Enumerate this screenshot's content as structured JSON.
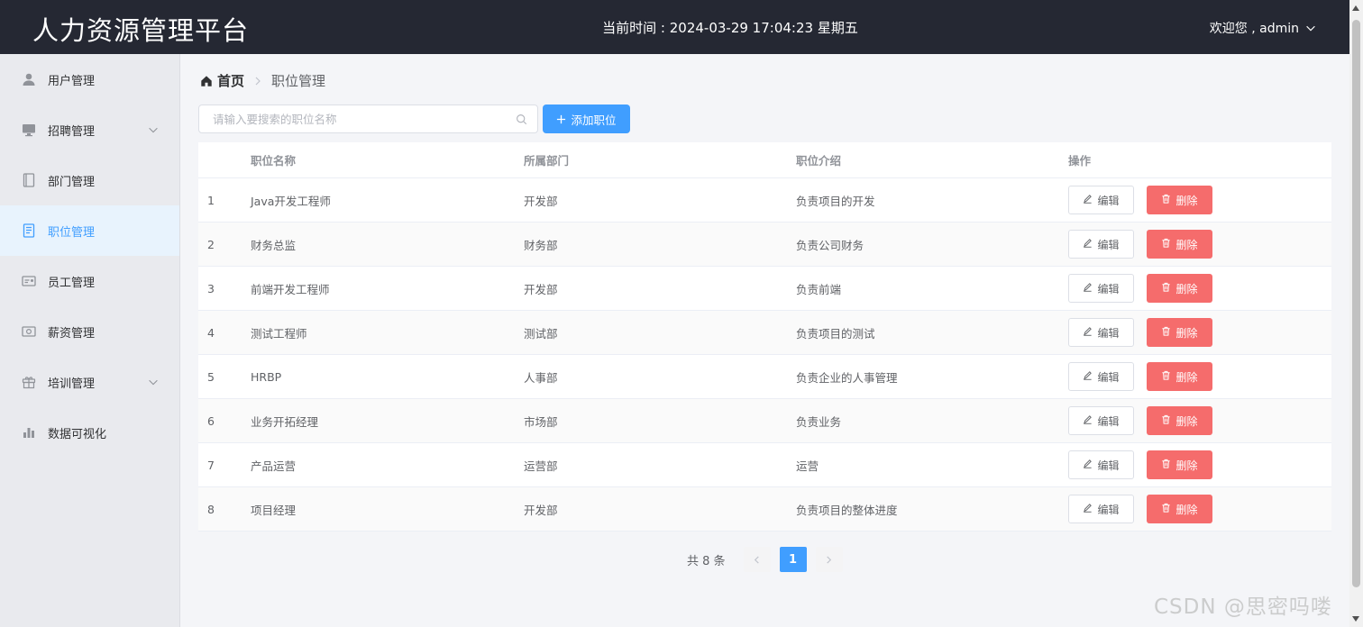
{
  "header": {
    "title": "人力资源管理平台",
    "clock": "当前时间 : 2024-03-29 17:04:23 星期五",
    "user": "欢迎您 , admin"
  },
  "sidebar": {
    "items": [
      {
        "label": "用户管理",
        "icon": "user-icon",
        "has_submenu": false
      },
      {
        "label": "招聘管理",
        "icon": "monitor-icon",
        "has_submenu": true
      },
      {
        "label": "部门管理",
        "icon": "notebook-icon",
        "has_submenu": false
      },
      {
        "label": "职位管理",
        "icon": "document-icon",
        "has_submenu": false,
        "active": true
      },
      {
        "label": "员工管理",
        "icon": "id-card-icon",
        "has_submenu": false
      },
      {
        "label": "薪资管理",
        "icon": "money-icon",
        "has_submenu": false
      },
      {
        "label": "培训管理",
        "icon": "gift-box-icon",
        "has_submenu": true
      },
      {
        "label": "数据可视化",
        "icon": "bar-chart-icon",
        "has_submenu": false
      }
    ]
  },
  "breadcrumb": {
    "home": "首页",
    "current": "职位管理"
  },
  "search": {
    "placeholder": "请输入要搜索的职位名称",
    "value": ""
  },
  "toolbar": {
    "add_label": "添加职位"
  },
  "table": {
    "columns": [
      "",
      "职位名称",
      "所属部门",
      "职位介绍",
      "操作"
    ],
    "rows": [
      {
        "index": "1",
        "name": "Java开发工程师",
        "dept": "开发部",
        "desc": "负责项目的开发"
      },
      {
        "index": "2",
        "name": "财务总监",
        "dept": "财务部",
        "desc": "负责公司财务"
      },
      {
        "index": "3",
        "name": "前端开发工程师",
        "dept": "开发部",
        "desc": "负责前端"
      },
      {
        "index": "4",
        "name": "测试工程师",
        "dept": "测试部",
        "desc": "负责项目的测试"
      },
      {
        "index": "5",
        "name": "HRBP",
        "dept": "人事部",
        "desc": "负责企业的人事管理"
      },
      {
        "index": "6",
        "name": "业务开拓经理",
        "dept": "市场部",
        "desc": "负责业务"
      },
      {
        "index": "7",
        "name": "产品运营",
        "dept": "运营部",
        "desc": "运营"
      },
      {
        "index": "8",
        "name": "项目经理",
        "dept": "开发部",
        "desc": "负责项目的整体进度"
      }
    ],
    "edit_label": "编辑",
    "delete_label": "删除"
  },
  "pagination": {
    "total": "共 8 条",
    "current_page": "1"
  },
  "watermark": "CSDN @思密吗喽",
  "colors": {
    "primary": "#409eff",
    "danger": "#f56c6c",
    "header_bg": "#252833",
    "sidebar_bg": "#e9eaee"
  }
}
